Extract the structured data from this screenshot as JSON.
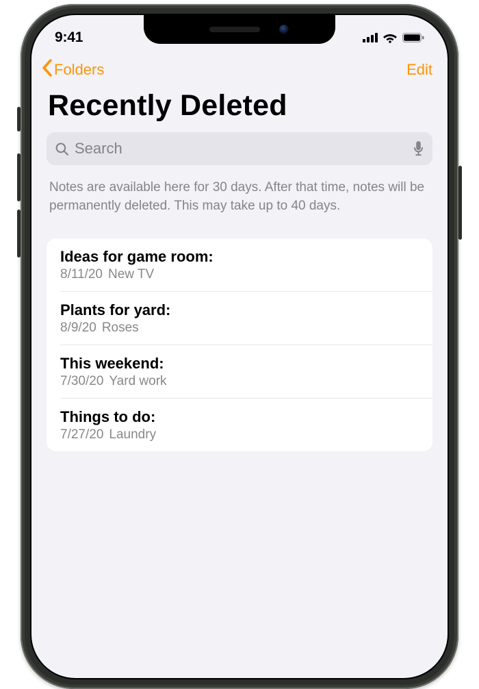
{
  "statusbar": {
    "time": "9:41"
  },
  "nav": {
    "back_label": "Folders",
    "edit_label": "Edit"
  },
  "page": {
    "title": "Recently Deleted"
  },
  "search": {
    "placeholder": "Search"
  },
  "notice_text": "Notes are available here for 30 days. After that time, notes will be permanently deleted. This may take up to 40 days.",
  "notes": [
    {
      "title": "Ideas for game room:",
      "date": "8/11/20",
      "preview": "New TV"
    },
    {
      "title": "Plants for yard:",
      "date": "8/9/20",
      "preview": "Roses"
    },
    {
      "title": "This weekend:",
      "date": "7/30/20",
      "preview": "Yard work"
    },
    {
      "title": "Things to do:",
      "date": "7/27/20",
      "preview": "Laundry"
    }
  ],
  "colors": {
    "accent": "#ff9500",
    "background": "#f2f2f7",
    "search_bg": "#e4e4ea"
  }
}
